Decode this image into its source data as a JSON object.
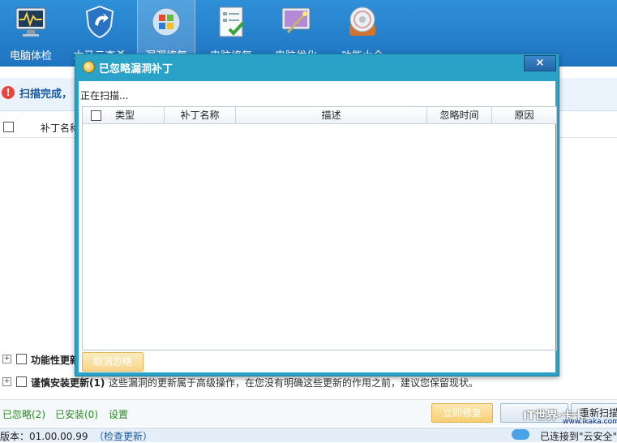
{
  "toolbar": {
    "items": [
      {
        "label": "电脑体检",
        "icon": "monitor-health-icon"
      },
      {
        "label": "木马云查杀",
        "icon": "shield-icon"
      },
      {
        "label": "漏洞修复",
        "icon": "windows-icon"
      },
      {
        "label": "电脑修复",
        "icon": "checklist-icon"
      },
      {
        "label": "电脑优化",
        "icon": "wand-icon"
      },
      {
        "label": "功能大全",
        "icon": "disc-icon"
      }
    ]
  },
  "main": {
    "scan_status": "扫描完成，",
    "column_patch_name": "补丁名称",
    "optional_updates": {
      "title": "功能性更新"
    },
    "careful_updates": {
      "title": "谨慎安装更新(1)",
      "desc": "这些漏洞的更新属于高级操作，在您没有明确这些更新的作用之前，建议您保留现状。"
    },
    "links": {
      "ignored": "已忽略(2)",
      "installed": "已安装(0)",
      "settings": "设置"
    },
    "fix_now_button": "立即修复",
    "rescan_button": "重新扫描"
  },
  "footer": {
    "version": "版本：01.00.00.99",
    "check_update": "（检查更新）",
    "cloud_status": "已连接到\"云安全\"("
  },
  "dialog": {
    "title": "已忽略漏洞补丁",
    "close": "×",
    "status": "正在扫描...",
    "columns": [
      "类型",
      "补丁名称",
      "描述",
      "忽略时间",
      "原因"
    ],
    "cancel_ignore_button": "取消忽略"
  },
  "watermark": {
    "text": "IT世界·卡卡",
    "url": "www.ikaka.com"
  }
}
